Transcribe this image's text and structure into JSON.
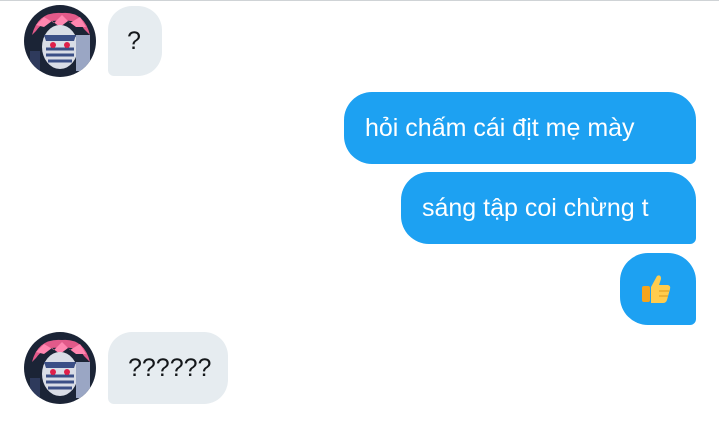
{
  "conversation": {
    "messages": [
      {
        "side": "received",
        "text": "?"
      },
      {
        "side": "sent",
        "text": "hỏi chấm cái địt mẹ mày"
      },
      {
        "side": "sent",
        "text": "sáng tập coi chừng t"
      },
      {
        "side": "sent",
        "emoji": "thumbs-up-icon"
      },
      {
        "side": "received",
        "text": "??????"
      }
    ]
  },
  "colors": {
    "sent_bubble": "#1da1f2",
    "received_bubble": "#e6ecf0",
    "received_text": "#14171a",
    "sent_text": "#ffffff"
  }
}
